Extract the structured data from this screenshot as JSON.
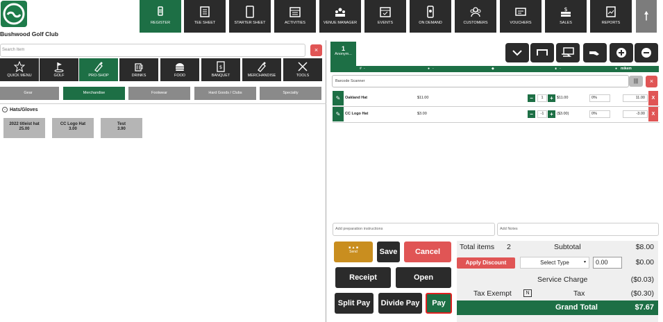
{
  "header": {
    "club_name": "Bushwood Golf Club",
    "nav": [
      {
        "label": "REGISTER",
        "icon": "barcode-scanner-icon",
        "active": true
      },
      {
        "label": "TEE SHEET",
        "icon": "tee-sheet-icon"
      },
      {
        "label": "STARTER SHEET",
        "icon": "tablet-icon"
      },
      {
        "label": "ACTIVITIES",
        "icon": "calendar-list-icon"
      },
      {
        "label": "VENUE MANAGER",
        "icon": "venue-people-icon"
      },
      {
        "label": "EVENTS",
        "icon": "events-calendar-icon"
      },
      {
        "label": "ON DEMAND",
        "icon": "mobile-phone-icon"
      },
      {
        "label": "CUSTOMERS",
        "icon": "customers-icon"
      },
      {
        "label": "VOUCHERS",
        "icon": "voucher-icon"
      },
      {
        "label": "SALES",
        "icon": "money-stack-icon"
      },
      {
        "label": "REPORTS",
        "icon": "report-chart-icon"
      }
    ]
  },
  "left": {
    "search_placeholder": "Search Item",
    "categories": [
      {
        "label": "QUICK MENU",
        "icon": "star-icon"
      },
      {
        "label": "GOLF",
        "icon": "golf-icon"
      },
      {
        "label": "PRO-SHOP",
        "icon": "pro-shop-icon",
        "active": true
      },
      {
        "label": "DRINKS",
        "icon": "drink-mug-icon"
      },
      {
        "label": "FOOD",
        "icon": "burger-icon"
      },
      {
        "label": "BANQUET",
        "icon": "banquet-menu-icon"
      },
      {
        "label": "MERCHANDISE",
        "icon": "merchandise-icon"
      },
      {
        "label": "TOOLS",
        "icon": "tools-icon"
      }
    ],
    "subcategories": [
      {
        "label": "Gear"
      },
      {
        "label": "Merchandise",
        "active": true
      },
      {
        "label": "Footwear"
      },
      {
        "label": "Hard Goods / Clubs"
      },
      {
        "label": "Specialty"
      }
    ],
    "group_title": "Hats/Gloves",
    "group_toggle": "-",
    "tiles": [
      {
        "name": "2022 titleist hat",
        "price": "25.00"
      },
      {
        "name": "CC Logo Hat",
        "price": "3.00"
      },
      {
        "name": "Test",
        "price": "3.90"
      }
    ]
  },
  "right": {
    "customer_tab": {
      "number": "1",
      "name": "Anonym..."
    },
    "header_cols": {
      "c1": "-",
      "c2": "-",
      "c3": "-",
      "c4": "-",
      "user": "mikem"
    },
    "barcode_placeholder": "Barcode Scanner",
    "items": [
      {
        "name": "Oakland Hat",
        "price": "$11.00",
        "qty": "1",
        "ext": "$11.00",
        "disc": "0%",
        "total": "11.00"
      },
      {
        "name": "CC Logo Hat",
        "price": "$3.00",
        "qty": "-1",
        "ext": "($3.00)",
        "disc": "0%",
        "total": "-3.00"
      }
    ],
    "prep_placeholder": "Add preparation instructions",
    "notes_placeholder": "Add Notes",
    "buttons": {
      "send": "Send",
      "save": "Save",
      "cancel": "Cancel",
      "receipt": "Receipt",
      "open": "Open",
      "split_pay": "Split Pay",
      "divide_pay": "Divide Pay",
      "pay": "Pay"
    },
    "totals": {
      "total_items_label": "Total items",
      "total_items": "2",
      "subtotal_label": "Subtotal",
      "subtotal": "$8.00",
      "apply_discount": "Apply Discount",
      "select_type": "Select Type",
      "discount_input": "0.00",
      "discount_amount": "$0.00",
      "service_charge_label": "Service Charge",
      "service_charge": "($0.03)",
      "tax_exempt_label": "Tax Exempt",
      "tax_exempt_box": "N",
      "tax_label": "Tax",
      "tax": "($0.30)",
      "grand_total_label": "Grand Total",
      "grand_total": "$7.67"
    },
    "colors": {
      "brand_green": "#1d6f45",
      "danger": "#e05555",
      "dark": "#2b2b2b"
    }
  }
}
